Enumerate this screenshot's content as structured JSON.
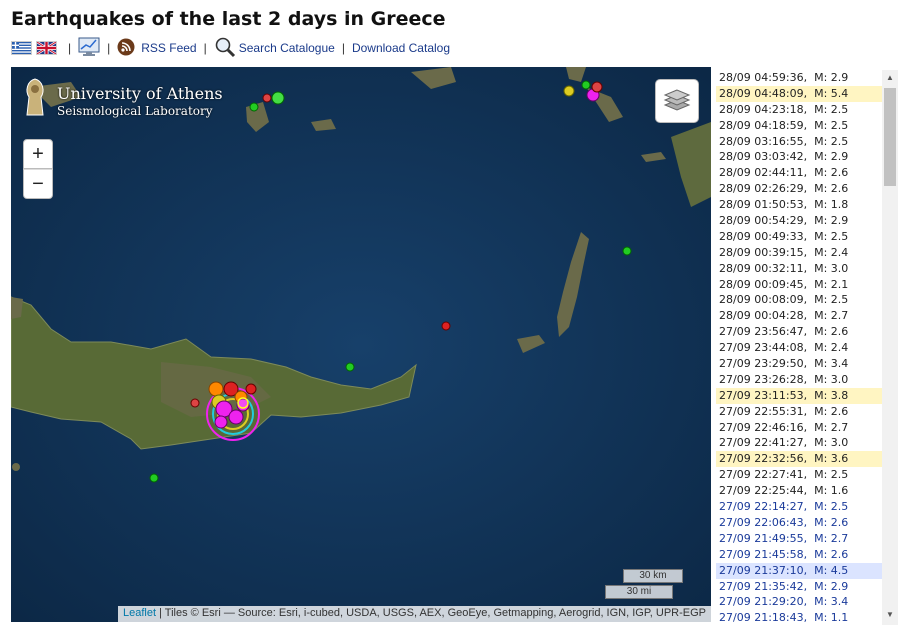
{
  "page": {
    "title": "Earthquakes of the last 2 days in Greece"
  },
  "toolbar": {
    "rss_label": "RSS Feed",
    "search_label": "Search Catalogue",
    "download_label": "Download Catalog",
    "separator": "|"
  },
  "map": {
    "brand_line1": "University of Athens",
    "brand_line2": "Seismological Laboratory",
    "zoom_in": "+",
    "zoom_out": "−",
    "scale_km": "30 km",
    "scale_mi": "30 mi",
    "attribution_leaflet": "Leaflet",
    "attribution_rest": " | Tiles © Esri — Source: Esri, i-cubed, USDA, USGS, AEX, GeoEye, Getmapping, Aerogrid, IGN, IGP, UPR-EGP"
  },
  "quakes": [
    {
      "time": "28/09 04:59:36,",
      "mag": "M: 2.9",
      "style": ""
    },
    {
      "time": "28/09 04:48:09,",
      "mag": "M: 5.4",
      "style": "hl-yellow"
    },
    {
      "time": "28/09 04:23:18,",
      "mag": "M: 2.5",
      "style": ""
    },
    {
      "time": "28/09 04:18:59,",
      "mag": "M: 2.5",
      "style": ""
    },
    {
      "time": "28/09 03:16:55,",
      "mag": "M: 2.5",
      "style": ""
    },
    {
      "time": "28/09 03:03:42,",
      "mag": "M: 2.9",
      "style": ""
    },
    {
      "time": "28/09 02:44:11,",
      "mag": "M: 2.6",
      "style": ""
    },
    {
      "time": "28/09 02:26:29,",
      "mag": "M: 2.6",
      "style": ""
    },
    {
      "time": "28/09 01:50:53,",
      "mag": "M: 1.8",
      "style": ""
    },
    {
      "time": "28/09 00:54:29,",
      "mag": "M: 2.9",
      "style": ""
    },
    {
      "time": "28/09 00:49:33,",
      "mag": "M: 2.5",
      "style": ""
    },
    {
      "time": "28/09 00:39:15,",
      "mag": "M: 2.4",
      "style": ""
    },
    {
      "time": "28/09 00:32:11,",
      "mag": "M: 3.0",
      "style": ""
    },
    {
      "time": "28/09 00:09:45,",
      "mag": "M: 2.1",
      "style": ""
    },
    {
      "time": "28/09 00:08:09,",
      "mag": "M: 2.5",
      "style": ""
    },
    {
      "time": "28/09 00:04:28,",
      "mag": "M: 2.7",
      "style": ""
    },
    {
      "time": "27/09 23:56:47,",
      "mag": "M: 2.6",
      "style": ""
    },
    {
      "time": "27/09 23:44:08,",
      "mag": "M: 2.4",
      "style": ""
    },
    {
      "time": "27/09 23:29:50,",
      "mag": "M: 3.4",
      "style": ""
    },
    {
      "time": "27/09 23:26:28,",
      "mag": "M: 3.0",
      "style": ""
    },
    {
      "time": "27/09 23:11:53,",
      "mag": "M: 3.8",
      "style": "hl-yellow"
    },
    {
      "time": "27/09 22:55:31,",
      "mag": "M: 2.6",
      "style": ""
    },
    {
      "time": "27/09 22:46:16,",
      "mag": "M: 2.7",
      "style": ""
    },
    {
      "time": "27/09 22:41:27,",
      "mag": "M: 3.0",
      "style": ""
    },
    {
      "time": "27/09 22:32:56,",
      "mag": "M: 3.6",
      "style": "hl-yellow"
    },
    {
      "time": "27/09 22:27:41,",
      "mag": "M: 2.5",
      "style": ""
    },
    {
      "time": "27/09 22:25:44,",
      "mag": "M: 1.6",
      "style": ""
    },
    {
      "time": "27/09 22:14:27,",
      "mag": "M: 2.5",
      "style": "recent"
    },
    {
      "time": "27/09 22:06:43,",
      "mag": "M: 2.6",
      "style": "recent"
    },
    {
      "time": "27/09 21:49:55,",
      "mag": "M: 2.7",
      "style": "recent"
    },
    {
      "time": "27/09 21:45:58,",
      "mag": "M: 2.6",
      "style": "recent"
    },
    {
      "time": "27/09 21:37:10,",
      "mag": "M: 4.5",
      "style": "hl-blue"
    },
    {
      "time": "27/09 21:35:42,",
      "mag": "M: 2.9",
      "style": "recent"
    },
    {
      "time": "27/09 21:29:20,",
      "mag": "M: 3.4",
      "style": "recent"
    },
    {
      "time": "27/09 21:18:43,",
      "mag": "M: 1.1",
      "style": "recent"
    }
  ],
  "colors": {
    "link": "#1a3a8a",
    "sea": "#0e2c4c",
    "land": "#5a6b3a",
    "highlight_yellow": "#fff5c2",
    "highlight_blue": "#dbe4ff"
  }
}
